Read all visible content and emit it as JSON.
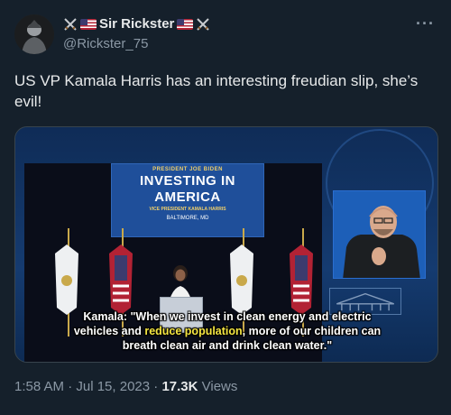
{
  "author": {
    "name_prefix_icons": [
      "crossed-swords-icon",
      "us-flag-icon"
    ],
    "display_name": "Sir Rickster",
    "name_suffix_icons": [
      "us-flag-icon",
      "crossed-swords-icon"
    ],
    "handle": "@Rickster_75"
  },
  "more_icon": "more-horizontal-icon",
  "tweet_text": "US VP Kamala Harris has an interesting freudian slip, she’s evil!",
  "media": {
    "banner": {
      "line1": "PRESIDENT JOE BIDEN",
      "line2": "INVESTING IN",
      "line3": "AMERICA",
      "line4": "VICE PRESIDENT KAMALA HARRIS",
      "line5": "BALTIMORE, MD"
    },
    "caption_part1": "Kamala: \"When we invest in clean energy and electric",
    "caption_part2a": "vehicles and ",
    "caption_highlight": "reduce population",
    "caption_part2b": ", more of our children can",
    "caption_part3": "breath clean air and drink clean water.\"",
    "caption_highlight_color": "#f5e642",
    "watermark": "THE WHITE HOUSE"
  },
  "meta": {
    "timestamp": "1:58 AM · Jul 15, 2023 · ",
    "views_count": "17.3K",
    "views_label": " Views"
  },
  "colors": {
    "background": "#15202b",
    "text_primary": "#e7e9ea",
    "text_secondary": "#8b98a5"
  }
}
